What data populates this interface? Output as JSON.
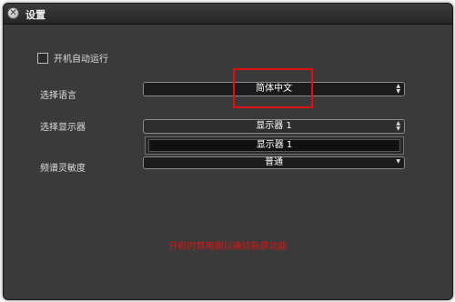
{
  "window": {
    "title": "设置",
    "close_icon": "close-icon"
  },
  "settings": {
    "autostart": {
      "label": "开机自动运行",
      "checked": false
    },
    "language": {
      "label": "选择语言",
      "value": "简体中文"
    },
    "display": {
      "label": "选择显示器",
      "value": "显示器 1",
      "open_options": [
        "显示器 1"
      ]
    },
    "sensitivity": {
      "label": "频谱灵敏度",
      "value": "普通"
    }
  },
  "footer": {
    "notice": "开机时禁用删以确验新原功能"
  },
  "colors": {
    "window_bg": "#3a3a3a",
    "highlight_red": "#e01010",
    "notice_red": "#e01414"
  }
}
